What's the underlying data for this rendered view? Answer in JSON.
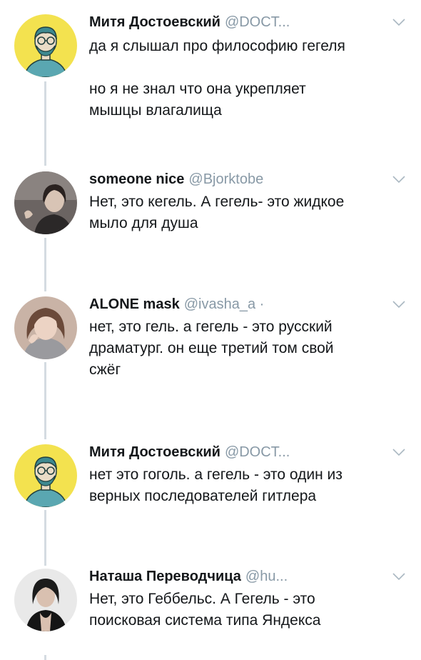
{
  "tweets": [
    {
      "name": "Митя Достоевский",
      "handle": "@DOCT...",
      "text": "да я слышал про философию гегеля\n\nно я не знал что она укрепляет\nмышцы влагалища",
      "avatar_icon": "avatar-illustrated-man",
      "avatar_color": "#f3e24f"
    },
    {
      "name": "someone nice",
      "handle": "@Bjorktobe",
      "text": "Нет, это кегель. А гегель- это жидкое\nмыло для душа",
      "avatar_icon": "avatar-photo-woman",
      "avatar_color": "#6b6462"
    },
    {
      "name": "ALONE mask",
      "handle": "@ivasha_a ·",
      "text": "нет, это гель. а гегель - это русский\nдраматург. он еще третий том свой\nсжёг",
      "avatar_icon": "avatar-photo-girl",
      "avatar_color": "#c9b3a6"
    },
    {
      "name": "Митя Достоевский",
      "handle": "@DOCT...",
      "text": "нет это гоголь. а гегель - это один из\nверных последователей гитлера",
      "avatar_icon": "avatar-illustrated-man",
      "avatar_color": "#f3e24f"
    },
    {
      "name": "Наташа Переводчица",
      "handle": "@hu...",
      "text": "Нет, это Геббельс. А Гегель - это\nпоисковая система типа Яндекса",
      "avatar_icon": "avatar-photo-woman-dark",
      "avatar_color": "#e9e9e9"
    }
  ],
  "colors": {
    "name": "#14171a",
    "handle": "#8899a6",
    "thread_line": "#d4dbe1",
    "chevron": "#aab8c2"
  }
}
